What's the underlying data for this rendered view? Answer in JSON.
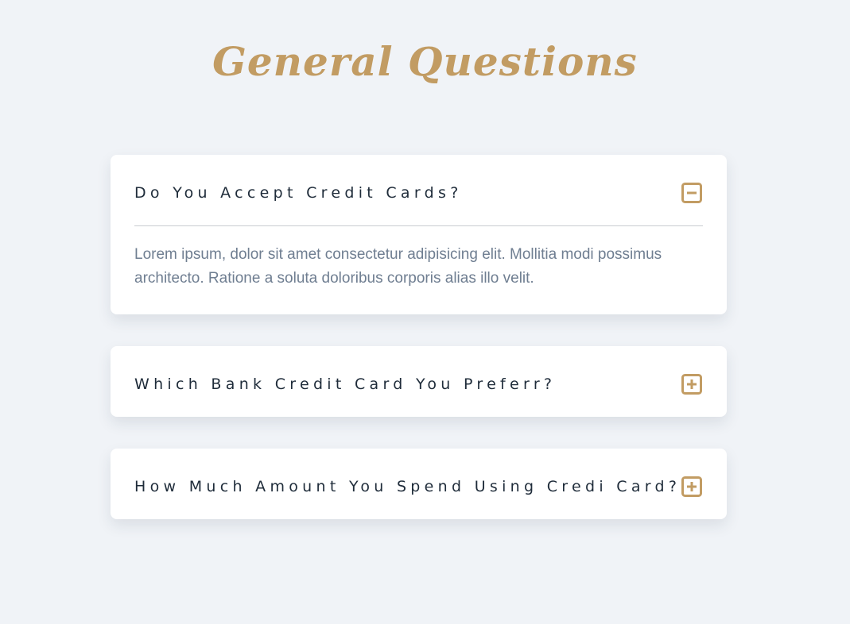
{
  "header": {
    "title": "General Questions"
  },
  "faq": {
    "items": [
      {
        "question": "Do You Accept Credit Cards?",
        "answer": "Lorem ipsum, dolor sit amet consectetur adipisicing elit. Mollitia modi possimus architecto. Ratione a soluta doloribus corporis alias illo velit.",
        "expanded": true,
        "icon": "minus-square-icon"
      },
      {
        "question": "Which Bank Credit Card You Preferr?",
        "expanded": false,
        "icon": "plus-square-icon"
      },
      {
        "question": "How Much Amount You Spend Using Credi Card?",
        "expanded": false,
        "icon": "plus-square-icon"
      }
    ]
  },
  "colors": {
    "accent": "#c29c63",
    "background": "#f0f3f7",
    "card": "#ffffff",
    "question_text": "#1f2c3a",
    "answer_text": "#6f7e91",
    "divider": "#c9ccd1"
  }
}
